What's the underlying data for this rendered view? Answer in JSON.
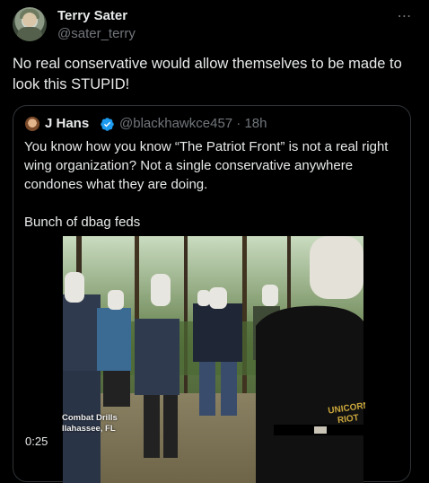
{
  "tweet": {
    "display_name": "Terry Sater",
    "handle": "@sater_terry",
    "more_icon": "⋯",
    "text": "No real conservative would allow themselves to be made to look this STUPID!"
  },
  "quote": {
    "display_name": "J Hans",
    "handle_time": "@blackhawkce457 · 18h",
    "text_lines": [
      "You know how you know “The Patriot Front” is not a real right wing organization? Not a single conservative anywhere condones what they are doing.",
      "Bunch of dbag feds"
    ],
    "video": {
      "duration": "0:25",
      "caption_line1": "Combat Drills",
      "caption_line2": "llahassee, FL",
      "watermark_line1": "UNICORN",
      "watermark_line2": "RIOT"
    }
  },
  "colors": {
    "background": "#000000",
    "text": "#e7e9ea",
    "secondary_text": "#71767b",
    "border": "#2f3336",
    "verified": "#1d9bf0"
  }
}
